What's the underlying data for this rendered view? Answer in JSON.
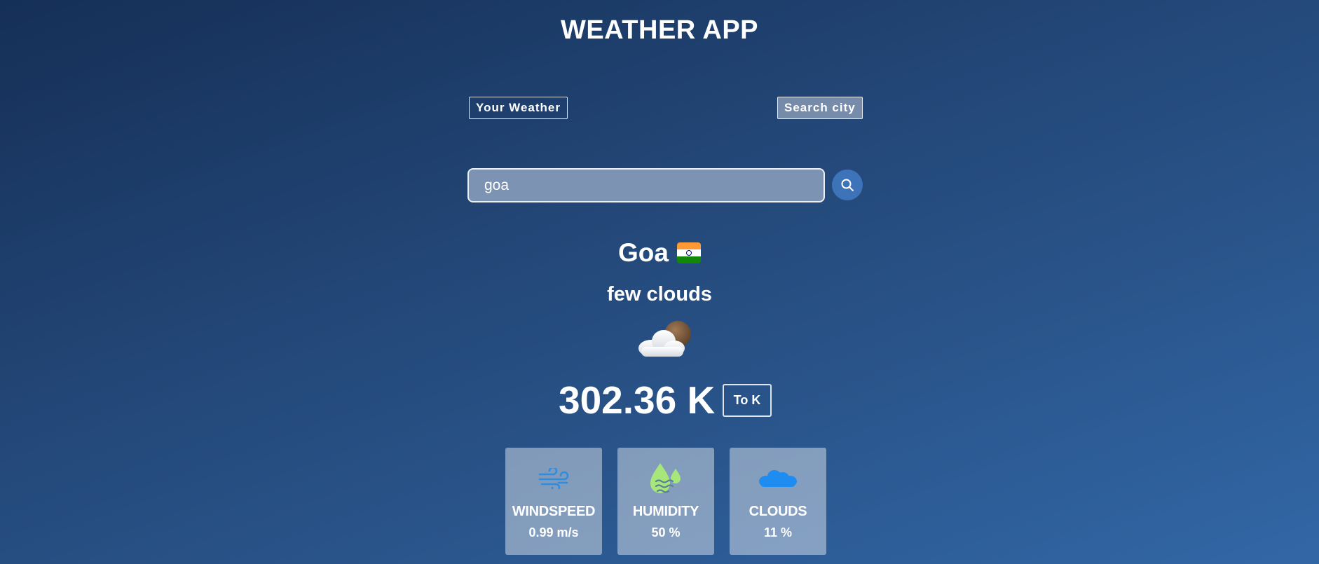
{
  "app": {
    "title": "WEATHER APP"
  },
  "tabs": {
    "your_weather": "Your Weather",
    "search_city": "Search city"
  },
  "search": {
    "value": "goa",
    "icon": "search-icon"
  },
  "weather": {
    "city": "Goa",
    "country_flag": "india-flag",
    "description": "few clouds",
    "icon": "few-clouds-icon",
    "temperature": "302.36 K",
    "unit_button": "To K"
  },
  "stats": [
    {
      "label": "WINDSPEED",
      "value": "0.99 m/s",
      "icon": "wind-icon"
    },
    {
      "label": "HUMIDITY",
      "value": "50 %",
      "icon": "humidity-icon"
    },
    {
      "label": "CLOUDS",
      "value": "11 %",
      "icon": "clouds-icon"
    }
  ],
  "colors": {
    "background_start": "#152f57",
    "background_end": "#3267a6",
    "search_button": "#3d73b8",
    "wind_icon": "#2f8de0",
    "humidity_icon": "#a6e67a",
    "clouds_icon": "#1e8cf0"
  }
}
